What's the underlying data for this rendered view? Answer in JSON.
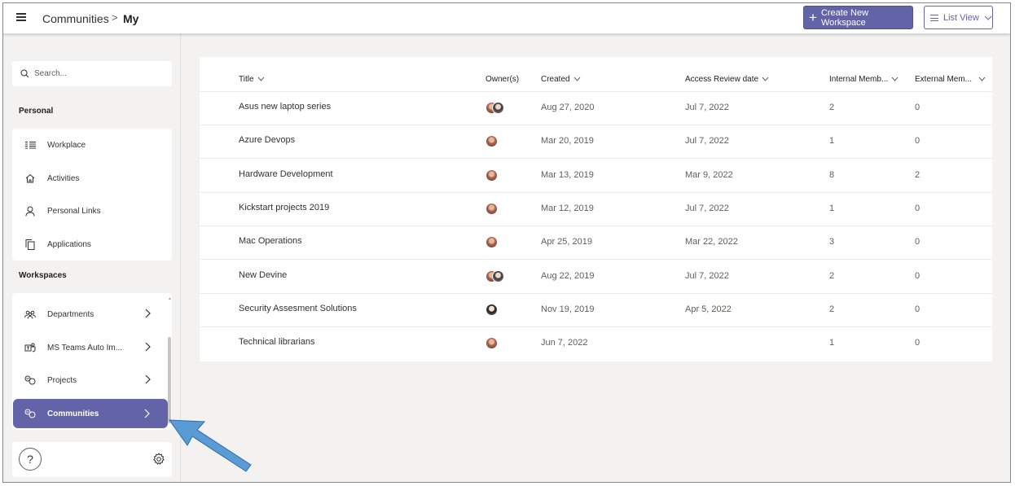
{
  "breadcrumb": {
    "root": "Communities",
    "separator": ">",
    "current": "My"
  },
  "toolbar": {
    "create_label": "Create New Workspace",
    "view_label": "List View"
  },
  "search": {
    "placeholder": "Search..."
  },
  "sidebar": {
    "personal_heading": "Personal",
    "personal_items": [
      {
        "label": "Workplace",
        "icon": "grid-list-icon"
      },
      {
        "label": "Activities",
        "icon": "home-icon"
      },
      {
        "label": "Personal Links",
        "icon": "person-icon"
      },
      {
        "label": "Applications",
        "icon": "copy-icon"
      }
    ],
    "workspaces_heading": "Workspaces",
    "workspace_items": [
      {
        "label": "Departments",
        "icon": "people-icon"
      },
      {
        "label": "MS Teams Auto Im...",
        "icon": "teams-icon"
      },
      {
        "label": "Projects",
        "icon": "projects-icon"
      },
      {
        "label": "Communities",
        "icon": "communities-icon",
        "active": true
      }
    ]
  },
  "table": {
    "columns": [
      "Title",
      "Owner(s)",
      "Created",
      "Access Review date",
      "Internal Memb...",
      "External Mem..."
    ],
    "rows": [
      {
        "title": "Asus new laptop series",
        "owners": 2,
        "created": "Aug 27, 2020",
        "review": "Jul 7, 2022",
        "internal": "2",
        "external": "0"
      },
      {
        "title": "Azure Devops",
        "owners": 1,
        "created": "Mar 20, 2019",
        "review": "Jul 7, 2022",
        "internal": "1",
        "external": "0"
      },
      {
        "title": "Hardware Development",
        "owners": 1,
        "created": "Mar 13, 2019",
        "review": "Mar 9, 2022",
        "internal": "8",
        "external": "2"
      },
      {
        "title": "Kickstart projects 2019",
        "owners": 1,
        "created": "Mar 12, 2019",
        "review": "Jul 7, 2022",
        "internal": "1",
        "external": "0"
      },
      {
        "title": "Mac Operations",
        "owners": 1,
        "created": "Apr 25, 2019",
        "review": "Mar 22, 2022",
        "internal": "3",
        "external": "0"
      },
      {
        "title": "New Devine",
        "owners": 2,
        "created": "Aug 22, 2019",
        "review": "Jul 7, 2022",
        "internal": "2",
        "external": "0"
      },
      {
        "title": "Security Assesment Solutions",
        "owners": 1,
        "created": "Nov 19, 2019",
        "review": "Apr 5, 2022",
        "internal": "2",
        "external": "0"
      },
      {
        "title": "Technical librarians",
        "owners": 1,
        "created": "Jun 7, 2022",
        "review": "",
        "internal": "1",
        "external": "0"
      }
    ]
  },
  "colors": {
    "accent": "#6264a7",
    "arrow": "#5b9bd5"
  }
}
